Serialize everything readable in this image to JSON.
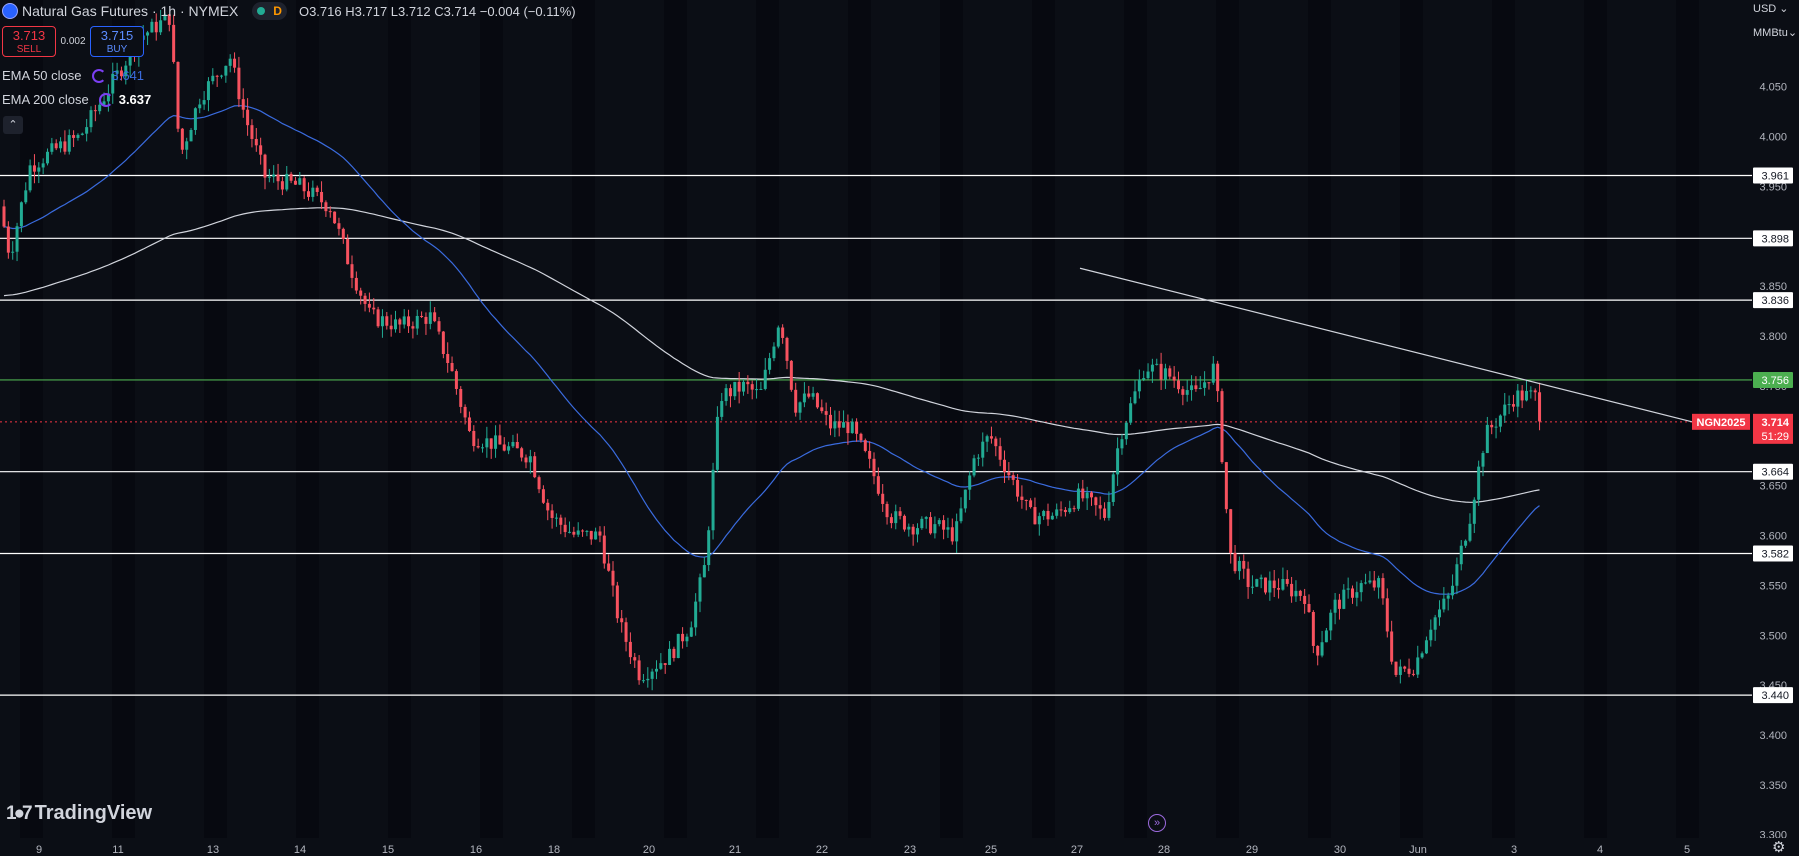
{
  "header": {
    "symbol_title": "Natural Gas Futures · 1h · NYMEX",
    "session_badge": "D",
    "ohlc": {
      "open": "O3.716",
      "high": "H3.717",
      "low": "L3.712",
      "close": "C3.714",
      "change": "−0.004 (−0.11%)"
    }
  },
  "trade": {
    "sell_price": "3.713",
    "sell_label": "SELL",
    "spread": "0.002",
    "buy_price": "3.715",
    "buy_label": "BUY"
  },
  "indicators": [
    {
      "label": "EMA 50 close",
      "value": "3.641",
      "color": "#3a6bde"
    },
    {
      "label": "EMA 200 close",
      "value": "3.637",
      "color": "#ffffff"
    }
  ],
  "currency": "USD",
  "unit": "MMBtu",
  "brand": "TradingView",
  "chart_data": {
    "type": "candlestick",
    "y_ticks": [
      "4.050",
      "4.000",
      "3.950",
      "3.850",
      "3.800",
      "3.750",
      "3.650",
      "3.600",
      "3.550",
      "3.500",
      "3.450",
      "3.400",
      "3.350",
      "3.300"
    ],
    "y_range": [
      3.3,
      4.05
    ],
    "x_labels": [
      "9",
      "11",
      "13",
      "14",
      "15",
      "16",
      "18",
      "20",
      "21",
      "22",
      "23",
      "25",
      "27",
      "28",
      "29",
      "30",
      "Jun",
      "3",
      "4",
      "5"
    ],
    "horizontal_levels": [
      {
        "value": 3.961,
        "label": "3.961",
        "color": "#ffffff"
      },
      {
        "value": 3.898,
        "label": "3.898",
        "color": "#ffffff"
      },
      {
        "value": 3.836,
        "label": "3.836",
        "color": "#ffffff"
      },
      {
        "value": 3.756,
        "label": "3.756",
        "color": "#4caf50"
      },
      {
        "value": 3.664,
        "label": "3.664",
        "color": "#ffffff"
      },
      {
        "value": 3.582,
        "label": "3.582",
        "color": "#ffffff"
      },
      {
        "value": 3.44,
        "label": "3.440",
        "color": "#ffffff"
      }
    ],
    "last_price": {
      "symbol": "NGN2025",
      "price": "3.714",
      "countdown": "51:29",
      "color": "#f23645"
    },
    "trend_line": {
      "from": {
        "x": "27",
        "y": 3.868
      },
      "to": {
        "x": "3-4",
        "y": 3.714
      }
    },
    "ema50_close": 3.641,
    "ema200_close": 3.637,
    "up_color": "#22ab94",
    "down_color": "#f7525f"
  }
}
